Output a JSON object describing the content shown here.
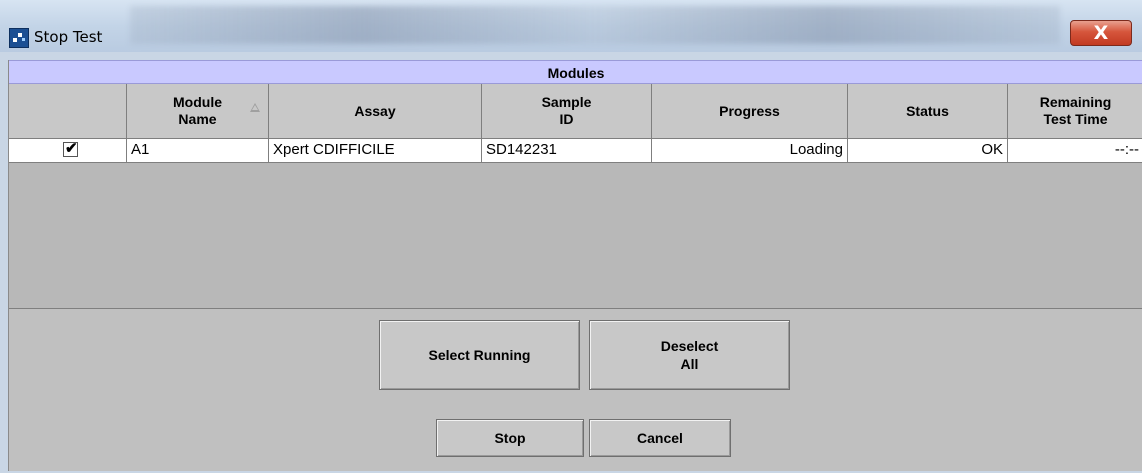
{
  "window": {
    "title": "Stop Test"
  },
  "modules_header": "Modules",
  "table": {
    "columns": [
      {
        "label": ""
      },
      {
        "label": "Module\nName"
      },
      {
        "label": "Assay"
      },
      {
        "label": "Sample\nID"
      },
      {
        "label": "Progress"
      },
      {
        "label": "Status"
      },
      {
        "label": "Remaining\nTest Time"
      }
    ],
    "rows": [
      {
        "checked": "✔",
        "module_name": "A1",
        "assay": "Xpert CDIFFICILE",
        "sample_id": "SD142231",
        "progress": "Loading",
        "status": "OK",
        "remaining": "--:--"
      }
    ]
  },
  "buttons": {
    "select_running": "Select Running",
    "deselect_all": "Deselect\nAll",
    "stop": "Stop",
    "cancel": "Cancel",
    "close": "X"
  },
  "colors": {
    "modules_header_bg": "#c9c9ff",
    "close_button": "#c23b22"
  }
}
